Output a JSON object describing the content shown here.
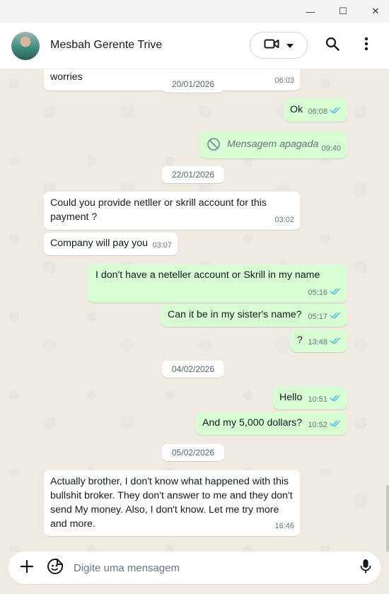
{
  "window": {
    "minimize_glyph": "—",
    "maximize_glyph": "☐",
    "close_glyph": "✕"
  },
  "header": {
    "contact_name": "Mesbah Gerente Trive",
    "icons": [
      "avatar",
      "video-call-icon",
      "chevron-down-icon",
      "search-icon",
      "more-vertical-icon"
    ]
  },
  "colors": {
    "outgoing_bubble": "#d9fdd3",
    "incoming_bubble": "#ffffff",
    "chat_background": "#efeae2",
    "read_ticks": "#53bdeb"
  },
  "messages": [
    {
      "dir": "in",
      "text": "worries",
      "time": "06:03"
    },
    {
      "type": "date",
      "text": "20/01/2026"
    },
    {
      "dir": "out",
      "text": "Ok",
      "time": "06:08",
      "read": true
    },
    {
      "dir": "out",
      "text": "Mensagem apagada",
      "time": "09:40",
      "deleted": true
    },
    {
      "type": "date",
      "text": "22/01/2026"
    },
    {
      "dir": "in",
      "text": "Could you provide netller or skrill account for this payment ?",
      "time": "03:02"
    },
    {
      "dir": "in",
      "text": "Company will pay you",
      "time": "03:07"
    },
    {
      "dir": "out",
      "text": "I don't have a neteller account or Skrill in my name",
      "time": "05:16",
      "read": true
    },
    {
      "dir": "out",
      "text": "Can it be in my sister's name?",
      "time": "05:17",
      "read": true
    },
    {
      "dir": "out",
      "text": "?",
      "time": "13:48",
      "read": true
    },
    {
      "type": "date",
      "text": "04/02/2026"
    },
    {
      "dir": "out",
      "text": "Hello",
      "time": "10:51",
      "read": true
    },
    {
      "dir": "out",
      "text": "And my 5,000 dollars?",
      "time": "10:52",
      "read": true
    },
    {
      "type": "date",
      "text": "05/02/2026"
    },
    {
      "dir": "in",
      "text": "Actually brother, I don't know what happened with this bullshit broker. They don't answer to me and they don't send My money. Also, I don't know. Let me try more and more.",
      "time": "16:46"
    }
  ],
  "composer": {
    "placeholder": "Digite uma mensagem",
    "icons": [
      "plus-icon",
      "sticker-icon",
      "microphone-icon"
    ]
  }
}
